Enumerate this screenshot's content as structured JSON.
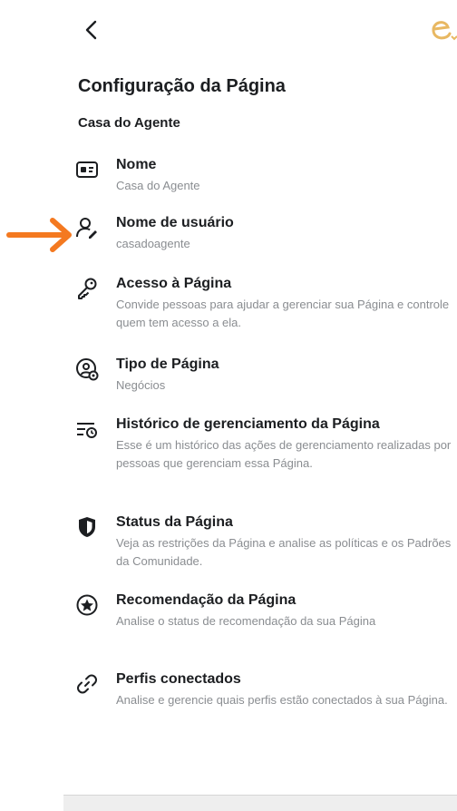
{
  "header": {
    "back_icon": "chevron-left-icon",
    "brand_icon": "e-logo-icon",
    "brand_color": "#e8b862"
  },
  "page": {
    "title": "Configuração da Página",
    "section": "Casa do Agente"
  },
  "items": [
    {
      "icon": "id-card-icon",
      "label": "Nome",
      "desc": "Casa do Agente"
    },
    {
      "icon": "user-pen-icon",
      "label": "Nome de usuário",
      "desc": "casadoagente"
    },
    {
      "icon": "key-icon",
      "label": "Acesso à Página",
      "desc": "Convide pessoas para ajudar a gerenciar sua Página e controle quem tem acesso a ela."
    },
    {
      "icon": "page-type-icon",
      "label": "Tipo de Página",
      "desc": "Negócios"
    },
    {
      "icon": "history-icon",
      "label": "Histórico de gerenciamento da Página",
      "desc": "Esse é um histórico das ações de gerenciamento realizadas por pessoas que gerenciam essa Página."
    },
    {
      "icon": "shield-icon",
      "label": "Status da Página",
      "desc": "Veja as restrições da Página e analise as políticas e os Padrões da Comunidade."
    },
    {
      "icon": "star-badge-icon",
      "label": "Recomendação da Página",
      "desc": "Analise o status de recomendação da sua Página"
    },
    {
      "icon": "link-icon",
      "label": "Perfis conectados",
      "desc": "Analise e gerencie quais perfis estão conectados à sua Página."
    }
  ],
  "annotation": {
    "arrow_color": "#f47920"
  }
}
